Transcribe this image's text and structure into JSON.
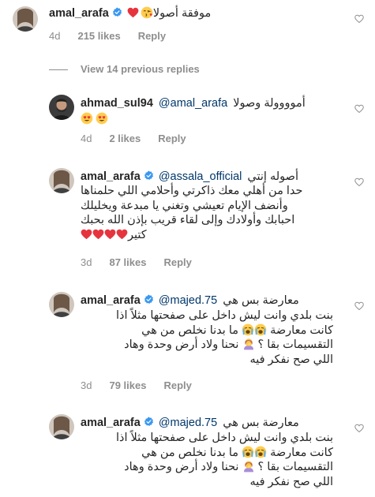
{
  "comments": [
    {
      "username": "amal_arafa",
      "text": "موفقة أصولا",
      "time": "4d",
      "likes": "215 likes",
      "reply": "Reply"
    }
  ],
  "view_replies": "View 14 previous replies",
  "replies": [
    {
      "username": "ahmad_sul94",
      "mention": "@amal_arafa",
      "text": "أموووولة وصولا",
      "time": "4d",
      "likes": "2 likes",
      "reply": "Reply"
    },
    {
      "username": "amal_arafa",
      "mention": "@assala_official",
      "lines": [
        "أصوله إنتي",
        "حدا من أهلي معك ذاكرتي وأحلامي اللي حلمناها",
        "وأنضف الإيام تعيشي وتغني يا مبدعة ويخليلك",
        "احبابك وأولادك وإلى لقاء قريب بإذن الله بحبك",
        "كتير"
      ],
      "time": "3d",
      "likes": "87 likes",
      "reply": "Reply"
    },
    {
      "username": "amal_arafa",
      "mention": "@majed.75",
      "lines": [
        "معارضة بس هي",
        "بنت بلدي وانت ليش داخل على صفحتها مثلاً اذا",
        "كانت معارضة",
        "ما بدنا نخلص من هي",
        "التقسيمات بقا ؟",
        "نحنا ولاد أرض وحدة وهاد",
        "اللي صح نفكر فيه"
      ],
      "time": "3d",
      "likes": "79 likes",
      "reply": "Reply"
    },
    {
      "username": "amal_arafa",
      "mention": "@majed.75",
      "lines": [
        "معارضة بس هي",
        "بنت بلدي وانت ليش داخل على صفحتها مثلاً اذا",
        "كانت معارضة",
        "ما بدنا نخلص من هي",
        "التقسيمات بقا ؟",
        "نحنا ولاد أرض وحدة وهاد",
        "اللي صح نفكر فيه"
      ]
    }
  ],
  "colors": {
    "text": "#262626",
    "meta": "#8e8e8e",
    "mention": "#00376b",
    "heart": "#ed4956",
    "verified": "#3897f0"
  }
}
